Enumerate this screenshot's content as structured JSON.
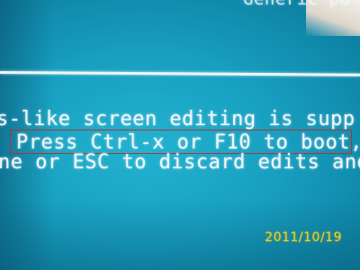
{
  "screen": {
    "top_text": "Generic pa",
    "lines": [
      "s-like screen editing is supp",
      "Press Ctrl-x or F10 to boot,",
      "ne or ESC to discard edits and"
    ]
  },
  "photo": {
    "timestamp": "2011/10/19",
    "timestamp_color": "#f4d21a",
    "screen_color": "#1a9fc0",
    "highlight_color": "#b8322f"
  }
}
